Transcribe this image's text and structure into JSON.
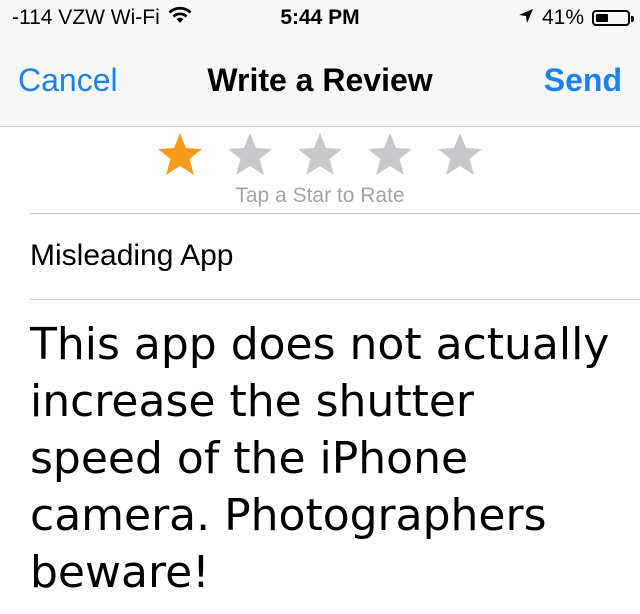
{
  "status_bar": {
    "carrier": "-114 VZW Wi-Fi",
    "wifi_icon": "wifi-icon",
    "time": "5:44 PM",
    "location_icon": "location-arrow-icon",
    "battery_percent": "41%",
    "battery_level": 0.41
  },
  "nav": {
    "cancel_label": "Cancel",
    "title": "Write a Review",
    "send_label": "Send"
  },
  "rating": {
    "selected": 1,
    "max": 5,
    "hint": "Tap a Star to Rate",
    "filled_color": "#f79b1c",
    "empty_color": "#c7c7cc"
  },
  "review": {
    "title": "Misleading App",
    "body": "This app does not actually increase the shutter speed of the iPhone camera. Photographers beware!"
  },
  "colors": {
    "accent": "#1a82f0"
  }
}
